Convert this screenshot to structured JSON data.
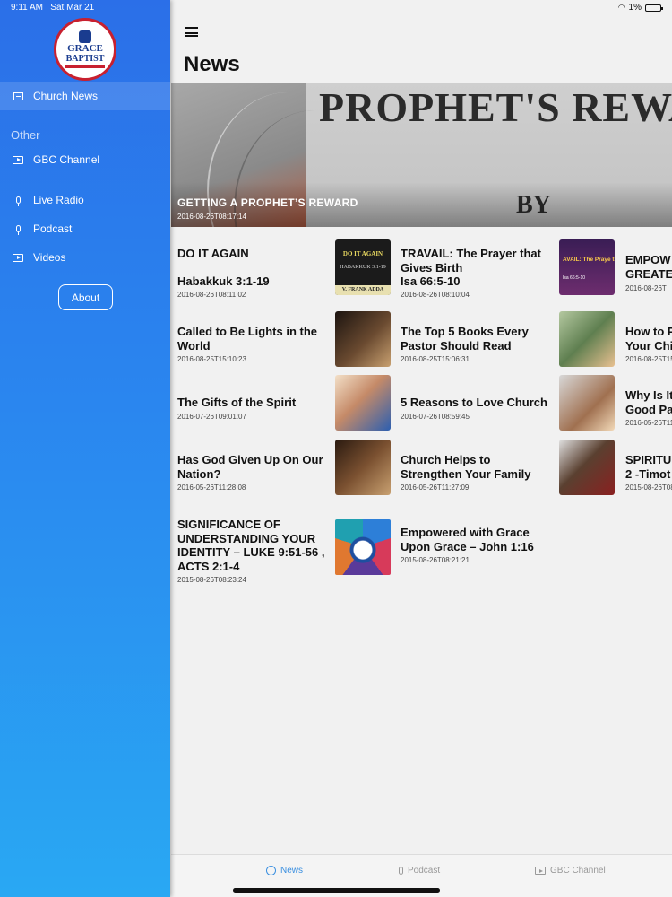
{
  "status": {
    "time": "9:11 AM",
    "date": "Sat Mar 21",
    "battery": "1%"
  },
  "sidebar": {
    "logo_line1": "GRACE",
    "logo_line2": "BAPTIST",
    "items": [
      {
        "label": "Church News",
        "icon": "newspaper-icon"
      },
      {
        "label": "GBC Channel",
        "icon": "tv-icon"
      },
      {
        "label": "Live Radio",
        "icon": "microphone-icon"
      },
      {
        "label": "Podcast",
        "icon": "microphone-icon"
      },
      {
        "label": "Videos",
        "icon": "tv-icon"
      }
    ],
    "section_other": "Other",
    "about_label": "About"
  },
  "main": {
    "title": "News",
    "hero": {
      "image_text": "PROPHET'S REWA",
      "image_by": "BY",
      "title": "GETTING A PROPHET’S REWARD",
      "date": "2016-08-26T08:17:14"
    },
    "articles": [
      {
        "title": "DO IT AGAIN\n\nHabakkuk 3:1-19",
        "date": "2016-08-26T08:11:02",
        "thumb_line1": "DO IT AGAIN",
        "thumb_line2": "HABAKKUK 3:1-19",
        "thumb_line3": "V. FRANK ADDA"
      },
      {
        "title": "TRAVAIL: The Prayer that Gives Birth\nIsa 66:5-10",
        "date": "2016-08-26T08:10:04",
        "thumb_line1": "AVAIL: The Praye that Gives Birth",
        "thumb_line2": "Isa 66:5-10"
      },
      {
        "title": "EMPOW GREATE",
        "date": "2016-08-26T",
        "thumb": "empowered-thumbnail"
      },
      {
        "title": "Called to Be Lights in the World",
        "date": "2016-08-25T15:10:23",
        "thumb": "bible-hands-thumbnail"
      },
      {
        "title": "The Top 5 Books Every Pastor Should Read",
        "date": "2016-08-25T15:06:31",
        "thumb": "books-group-thumbnail"
      },
      {
        "title": "How to P Your Chi",
        "date": "2016-08-25T15",
        "thumb": "people-thumbnail"
      },
      {
        "title": "The Gifts of the Spirit",
        "date": "2016-07-26T09:01:07",
        "thumb": "women-smiling-thumbnail"
      },
      {
        "title": "5 Reasons to Love Church",
        "date": "2016-07-26T08:59:45",
        "thumb": "church-thumbnail"
      },
      {
        "title": "Why Is It Good Pa",
        "date": "2016-05-26T11",
        "thumb": "hands-thumbnail"
      },
      {
        "title": "Has God Given Up On Our Nation?",
        "date": "2016-05-26T11:28:08",
        "thumb": "nation-thumbnail"
      },
      {
        "title": "Church Helps to Strengthen Your Family",
        "date": "2016-05-26T11:27:09",
        "thumb": "family-thumbnail"
      },
      {
        "title": "SPIRITU 2 -Timot",
        "date": "2015-08-26T08",
        "thumb": "spiritual-thumbnail"
      },
      {
        "title": "SIGNIFICANCE OF UNDERSTANDING YOUR IDENTITY – LUKE 9:51-56 , ACTS 2:1-4",
        "date": "2015-08-26T08:23:24"
      },
      {
        "title": "Empowered with Grace Upon Grace – John 1:16",
        "date": "2015-08-26T08:21:21",
        "thumb": "grace-diagram-thumbnail"
      }
    ]
  },
  "tabbar": {
    "tabs": [
      {
        "label": "News",
        "icon": "clock-icon",
        "active": true
      },
      {
        "label": "Podcast",
        "icon": "microphone-icon",
        "active": false
      },
      {
        "label": "GBC Channel",
        "icon": "tv-icon",
        "active": false
      }
    ]
  },
  "colors": {
    "accent": "#3a8fe0",
    "sidebar_top": "#2b6fe8",
    "sidebar_bottom": "#29a8f3"
  }
}
